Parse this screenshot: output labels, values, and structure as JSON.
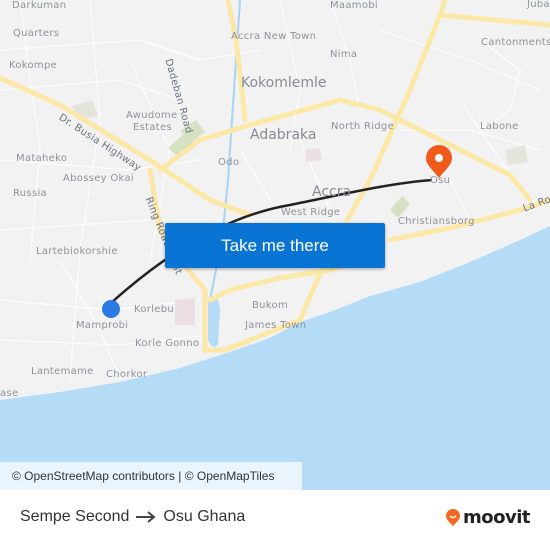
{
  "map": {
    "places": [
      {
        "id": "darkuman",
        "label": "Darkuman"
      },
      {
        "id": "quarters",
        "label": "Quarters"
      },
      {
        "id": "kokompe",
        "label": "Kokompe"
      },
      {
        "id": "awudome-estates-1",
        "label": "Awudome"
      },
      {
        "id": "awudome-estates-2",
        "label": "Estates"
      },
      {
        "id": "mataheko",
        "label": "Mataheko"
      },
      {
        "id": "abossey-okai",
        "label": "Abossey Okai"
      },
      {
        "id": "russia",
        "label": "Russia"
      },
      {
        "id": "lartebiokorshie",
        "label": "Lartebiokorshie"
      },
      {
        "id": "korlebu",
        "label": "Korlebu"
      },
      {
        "id": "mamprobi",
        "label": "Mamprobi"
      },
      {
        "id": "korle-gonno",
        "label": "Korle Gonno"
      },
      {
        "id": "lantemame",
        "label": "Lantemame"
      },
      {
        "id": "chorkor",
        "label": "Chorkor"
      },
      {
        "id": "ase",
        "label": "ase"
      },
      {
        "id": "maamobi",
        "label": "Maamobi"
      },
      {
        "id": "accra-new-town",
        "label": "Accra New Town"
      },
      {
        "id": "nima",
        "label": "Nima"
      },
      {
        "id": "kokomlemle",
        "label": "Kokomlemle"
      },
      {
        "id": "adabraka",
        "label": "Adabraka"
      },
      {
        "id": "odo",
        "label": "Odo"
      },
      {
        "id": "north-ridge",
        "label": "North Ridge"
      },
      {
        "id": "accra",
        "label": "Accra"
      },
      {
        "id": "west-ridge",
        "label": "West Ridge"
      },
      {
        "id": "bukom",
        "label": "Bukom"
      },
      {
        "id": "james-town",
        "label": "James Town"
      },
      {
        "id": "christiansborg",
        "label": "Christiansborg"
      },
      {
        "id": "osu",
        "label": "Osu"
      },
      {
        "id": "labone",
        "label": "Labone"
      },
      {
        "id": "cantonments",
        "label": "Cantonments"
      },
      {
        "id": "juba",
        "label": "Juba"
      }
    ],
    "roads": [
      {
        "id": "dadeban-road",
        "label": "Dadeban Road"
      },
      {
        "id": "dr-busia-highway",
        "label": "Dr. Busia Highway"
      },
      {
        "id": "ring-road",
        "label": "Ring Road West"
      },
      {
        "id": "la-road",
        "label": "La Ro"
      }
    ],
    "origin": {
      "name": "Sempe Second",
      "color": "#2c7be5"
    },
    "destination": {
      "name": "Osu Ghana",
      "color": "#f05a1a"
    },
    "colors": {
      "water": "#b5dcf7",
      "land": "#f2f2f3",
      "major_road": "#fbe7a6",
      "route": "#222222"
    }
  },
  "cta": {
    "label": "Take me there"
  },
  "attribution": "© OpenStreetMap contributors | © OpenMapTiles",
  "footer": {
    "from": "Sempe Second",
    "to": "Osu Ghana",
    "brand": "moovit",
    "brand_color": "#f26a21"
  }
}
